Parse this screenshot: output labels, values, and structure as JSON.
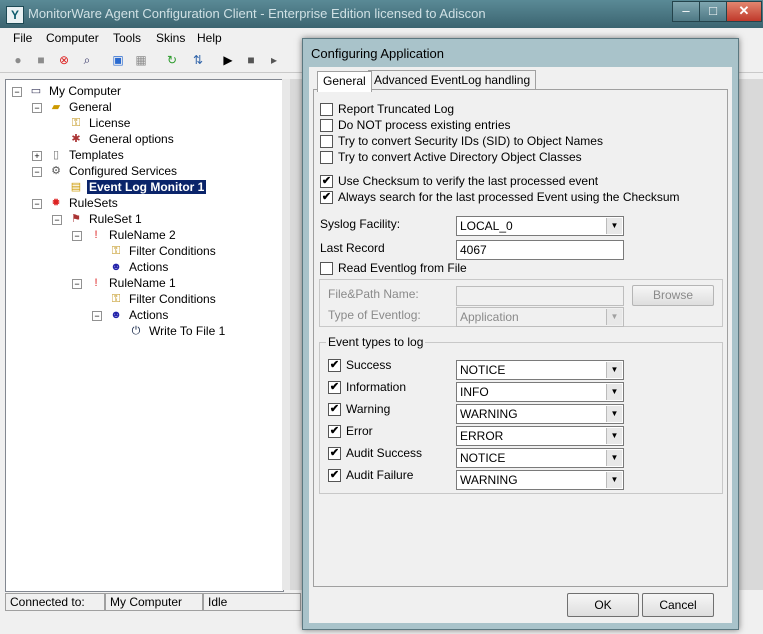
{
  "app": {
    "title": "MonitorWare Agent Configuration Client - Enterprise Edition licensed to Adiscon",
    "icon_glyph": "Y",
    "min": "–",
    "max": "□",
    "close": "✕"
  },
  "menu": [
    "File",
    "Computer",
    "Tools",
    "Skins",
    "Help"
  ],
  "toolbar_icons": [
    "check-icon",
    "save-icon",
    "stop-sign-icon",
    "search-icon",
    "network-icon",
    "grid-icon",
    "refresh-icon",
    "export-icon",
    "play-icon",
    "stop-icon",
    "step-icon"
  ],
  "tree": {
    "my_computer": "My Computer",
    "general": "General",
    "license": "License",
    "general_options": "General options",
    "templates": "Templates",
    "configured_services": "Configured Services",
    "event_log_monitor": "Event Log Monitor 1",
    "rulesets": "RuleSets",
    "ruleset1": "RuleSet 1",
    "rulename2": "RuleName 2",
    "filter_conditions_a": "Filter Conditions",
    "actions_a": "Actions",
    "rulename1": "RuleName 1",
    "filter_conditions_b": "Filter Conditions",
    "actions_b": "Actions",
    "write_to_file": "Write To File 1"
  },
  "status": {
    "connected_label": "Connected to:",
    "computer": "My Computer",
    "state": "Idle"
  },
  "dialog": {
    "title": "Configuring Application",
    "tabs": [
      "General",
      "Advanced EventLog handling"
    ],
    "options": [
      {
        "label": "Report Truncated Log",
        "checked": false
      },
      {
        "label": "Do NOT process existing entries",
        "checked": false
      },
      {
        "label": "Try to convert Security IDs (SID) to Object Names",
        "checked": false
      },
      {
        "label": "Try to convert Active Directory Object Classes",
        "checked": false
      },
      {
        "label": "Use Checksum to verify the last processed event",
        "checked": true
      },
      {
        "label": "Always search for the last processed Event using the Checksum",
        "checked": true
      }
    ],
    "check_mark": "✔",
    "syslog_facility_label": "Syslog Facility:",
    "syslog_facility_value": "LOCAL_0",
    "last_record_label": "Last Record",
    "last_record_value": "4067",
    "read_from_file_label": "Read Eventlog from File",
    "read_from_file_checked": false,
    "file_path_label": "File&Path Name:",
    "file_path_value": "",
    "browse_label": "Browse",
    "eventlog_type_label": "Type of Eventlog:",
    "eventlog_type_value": "Application",
    "event_types_legend": "Event types to log",
    "event_types": [
      {
        "label": "Success",
        "checked": true,
        "value": "NOTICE"
      },
      {
        "label": "Information",
        "checked": true,
        "value": "INFO"
      },
      {
        "label": "Warning",
        "checked": true,
        "value": "WARNING"
      },
      {
        "label": "Error",
        "checked": true,
        "value": "ERROR"
      },
      {
        "label": "Audit Success",
        "checked": true,
        "value": "NOTICE"
      },
      {
        "label": "Audit Failure",
        "checked": true,
        "value": "WARNING"
      }
    ],
    "ok_label": "OK",
    "cancel_label": "Cancel",
    "dropdown_arrow": "▼"
  }
}
